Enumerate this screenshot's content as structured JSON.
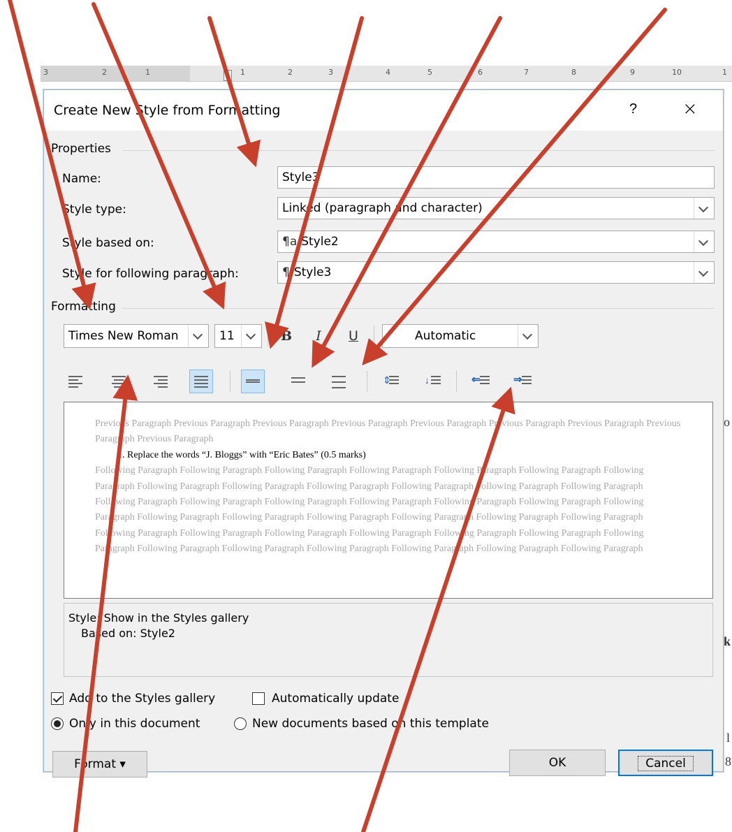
{
  "ruler": {
    "ticks": [
      "3",
      "2",
      "1",
      "1",
      "2",
      "3",
      "4",
      "5",
      "6",
      "7",
      "8",
      "9",
      "10",
      "1"
    ]
  },
  "dialog": {
    "title": "Create New Style from Formatting",
    "help_label": "?",
    "close_label": "×",
    "properties": {
      "section_label": "Properties",
      "name_label": "Name:",
      "name_value": "Style3",
      "style_type_label": "Style type:",
      "style_type_value": "Linked (paragraph and character)",
      "based_on_label": "Style based on:",
      "based_on_value": "Style2",
      "following_label": "Style for following paragraph:",
      "following_value": "Style3"
    },
    "formatting": {
      "section_label": "Formatting",
      "font": "Times New Roman",
      "size": "11",
      "bold": "B",
      "italic": "I",
      "underline": "U",
      "color": "Automatic"
    },
    "preview": {
      "previous": "Previous Paragraph Previous Paragraph Previous Paragraph Previous Paragraph Previous Paragraph Previous Paragraph Previous Paragraph Previous Paragraph Previous Paragraph",
      "current": "1.    Replace the words “J. Bloggs” with “Eric Bates”               (0.5 marks)",
      "following": "Following Paragraph Following Paragraph Following Paragraph Following Paragraph Following Paragraph Following Paragraph Following Paragraph Following Paragraph Following Paragraph Following Paragraph Following Paragraph Following Paragraph Following Paragraph Following Paragraph Following Paragraph Following Paragraph Following Paragraph Following Paragraph Following Paragraph Following Paragraph Following Paragraph Following Paragraph Following Paragraph Following Paragraph Following Paragraph Following Paragraph Following Paragraph Following Paragraph Following Paragraph Following Paragraph Following Paragraph Following Paragraph Following Paragraph Following Paragraph Following Paragraph Following Paragraph Following Paragraph Following Paragraph Following Paragraph"
    },
    "description": {
      "line1": "Style: Show in the Styles gallery",
      "line2": "Based on: Style2"
    },
    "add_to_gallery_label": "Add to the Styles gallery",
    "auto_update_label": "Automatically update",
    "only_this_doc_label": "Only in this document",
    "new_docs_label": "New documents based on this template",
    "format_button": "Format ▾",
    "ok_button": "OK",
    "cancel_button": "Cancel"
  },
  "background_edge": {
    "a": "o",
    "b": "k",
    "c": "l",
    "d": "8"
  },
  "colors": {
    "arrow": "#c8402c",
    "selection": "#cce4f7",
    "accent": "#0078d7"
  }
}
